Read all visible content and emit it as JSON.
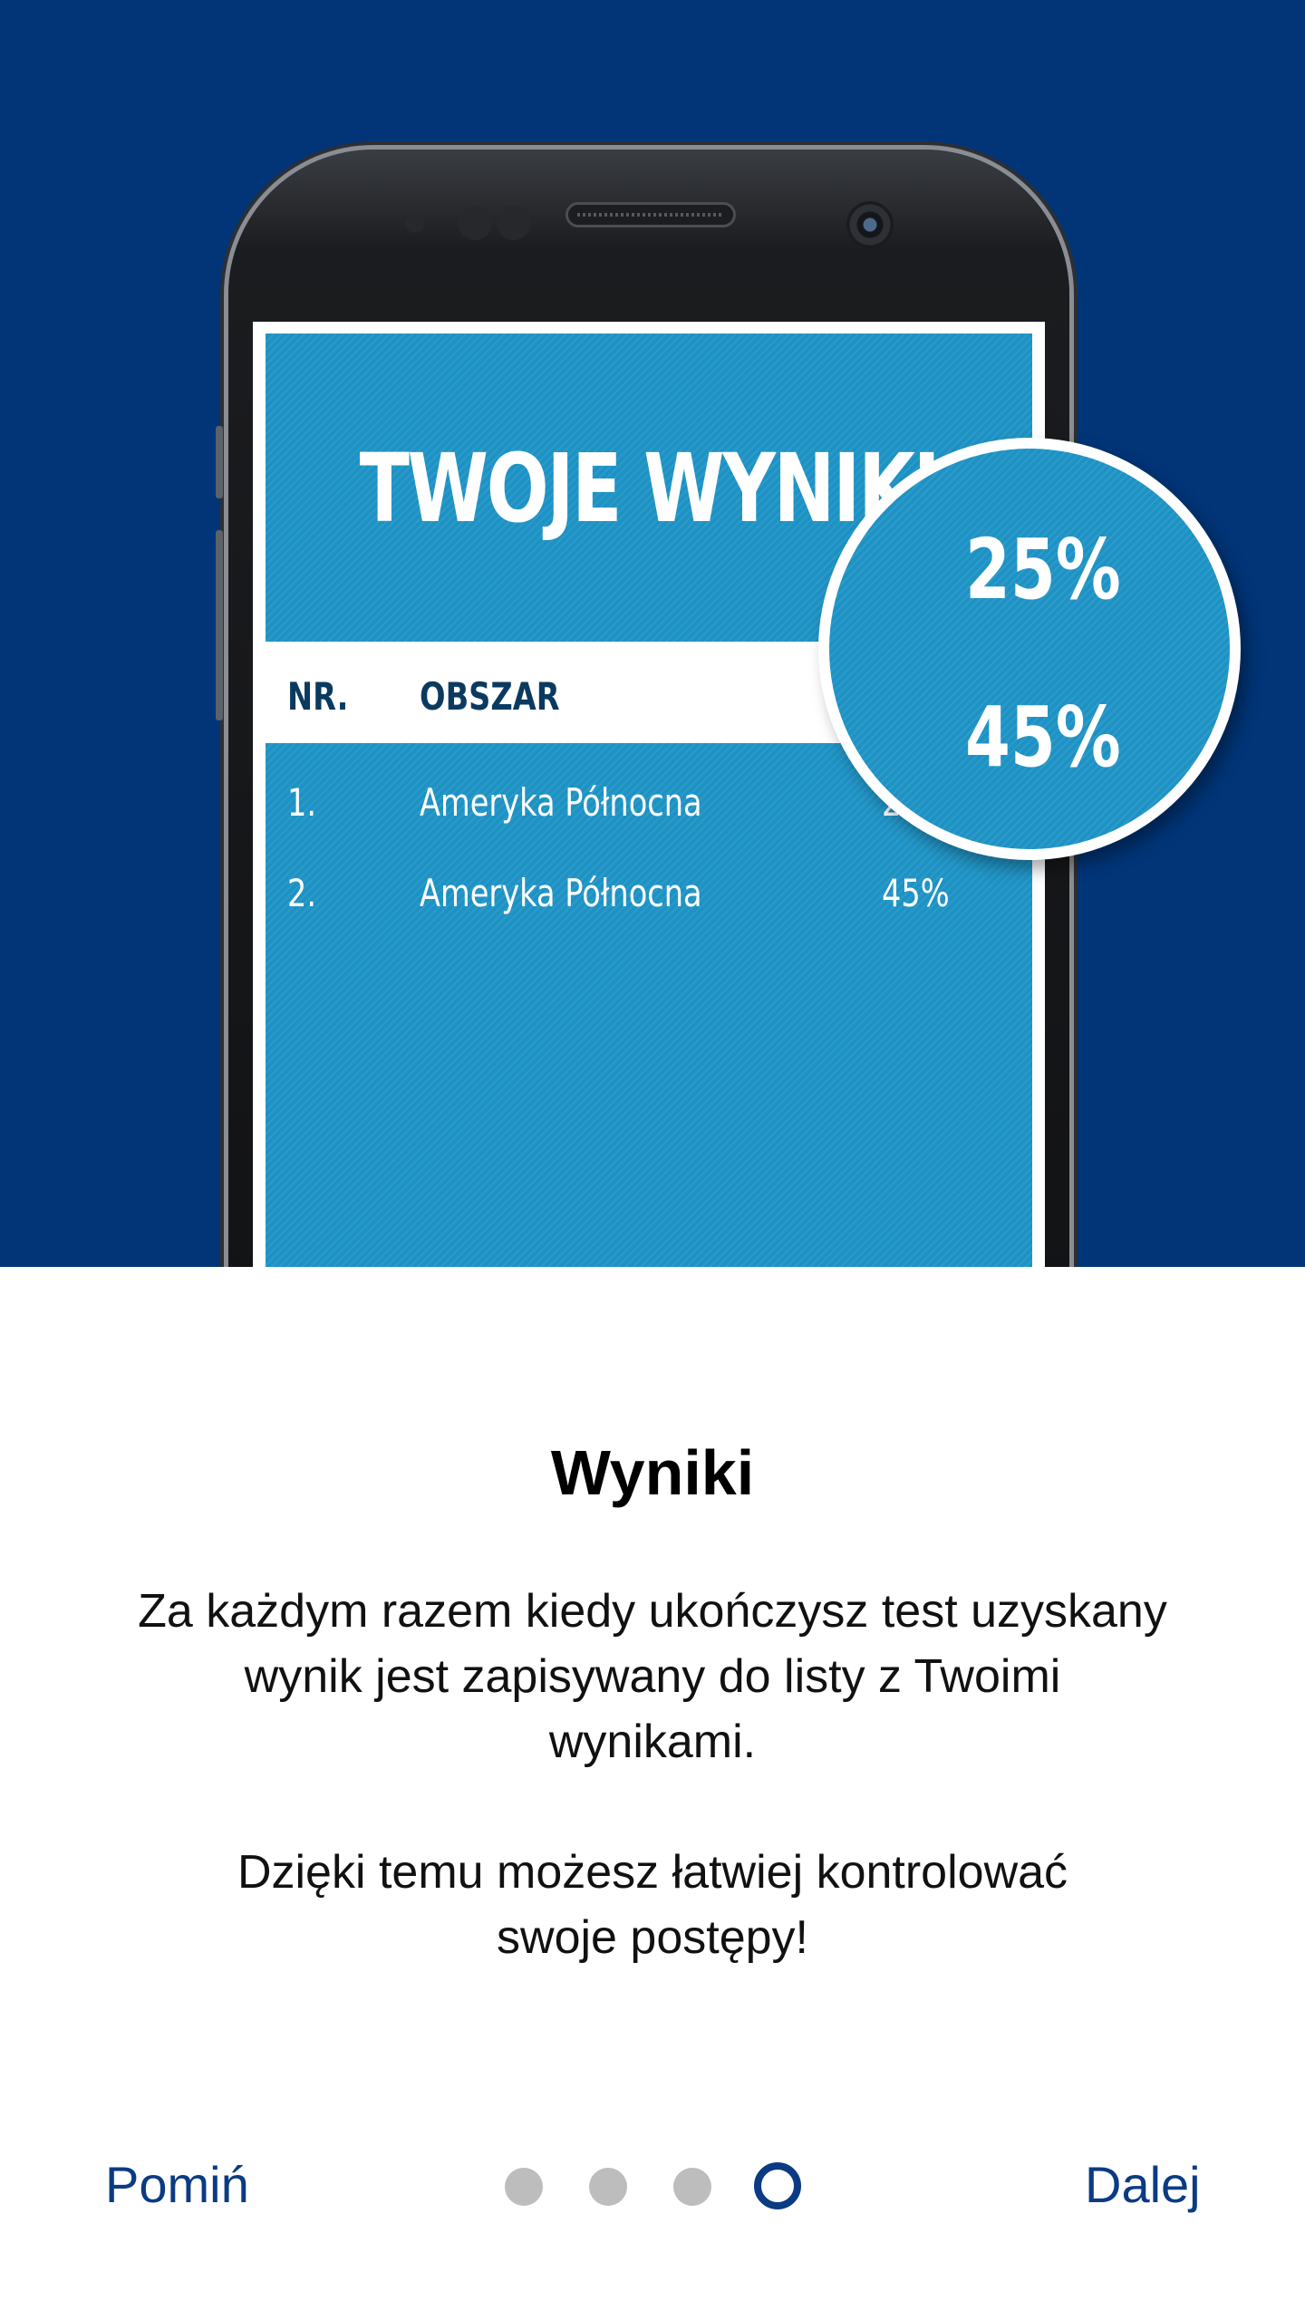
{
  "hero": {
    "screen": {
      "title": "TWOJE WYNIKI",
      "columns": [
        "NR.",
        "OBSZAR"
      ],
      "rows": [
        {
          "nr": "1.",
          "area": "Ameryka Północna",
          "score": "25%"
        },
        {
          "nr": "2.",
          "area": "Ameryka Północna",
          "score": "45%"
        }
      ]
    },
    "bubble": {
      "value_1": "25%",
      "value_2": "45%"
    }
  },
  "content": {
    "heading": "Wyniki",
    "paragraph_1_lines": [
      "Za każdym razem kiedy ukończysz test uzyskany",
      "wynik jest zapisywany do listy z Twoimi",
      "wynikami."
    ],
    "paragraph_2_lines": [
      "Dzięki temu możesz łatwiej kontrolować",
      "swoje postępy!"
    ]
  },
  "footer": {
    "skip_label": "Pomiń",
    "next_label": "Dalej",
    "pages_total": 4,
    "current_page": 4
  },
  "colors": {
    "hero_background": "#013578",
    "screen_blue": "#1d92c4",
    "accent": "#0b3b83"
  }
}
